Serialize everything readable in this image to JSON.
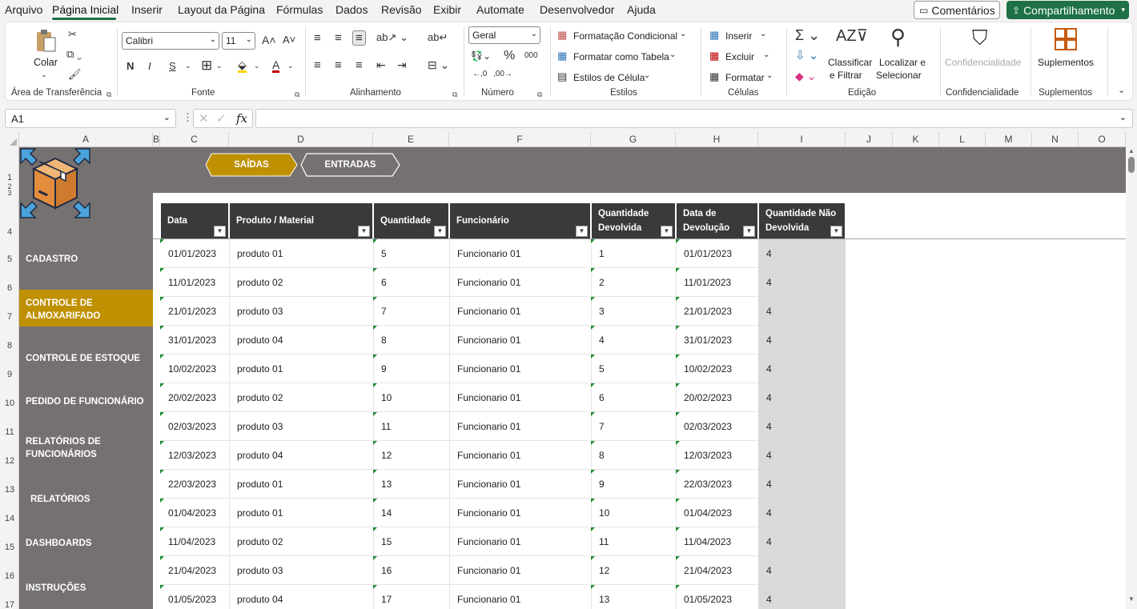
{
  "menu": {
    "items": [
      "Arquivo",
      "Página Inicial",
      "Inserir",
      "Layout da Página",
      "Fórmulas",
      "Dados",
      "Revisão",
      "Exibir",
      "Automate",
      "Desenvolvedor",
      "Ajuda"
    ],
    "comments": "Comentários",
    "share": "Compartilhamento"
  },
  "ribbon": {
    "clipboard": {
      "paste": "Colar",
      "label": "Área de Transferência"
    },
    "font": {
      "name": "Calibri",
      "size": "11",
      "bold": "N",
      "italic": "I",
      "underline": "S",
      "label": "Fonte"
    },
    "alignment": {
      "label": "Alinhamento"
    },
    "number": {
      "format": "Geral",
      "label": "Número"
    },
    "styles": {
      "conditional": "Formatação Condicional",
      "table": "Formatar como Tabela",
      "cell": "Estilos de Célula",
      "label": "Estilos"
    },
    "cells": {
      "insert": "Inserir",
      "delete": "Excluir",
      "format": "Formatar",
      "label": "Células"
    },
    "editing": {
      "sort1": "Classificar",
      "sort2": "e Filtrar",
      "find1": "Localizar e",
      "find2": "Selecionar",
      "label": "Edição"
    },
    "sensitivity": {
      "btn": "Confidencialidade",
      "label": "Confidencialidade"
    },
    "addins": {
      "btn": "Suplementos",
      "label": "Suplementos"
    }
  },
  "formula_bar": {
    "namebox": "A1",
    "fx": "fx",
    "value": ""
  },
  "columns": [
    "A",
    "B",
    "C",
    "D",
    "E",
    "F",
    "G",
    "H",
    "I",
    "J",
    "K",
    "L",
    "M",
    "N",
    "O"
  ],
  "rows": [
    "1",
    "2",
    "3",
    "4",
    "5",
    "6",
    "7",
    "8",
    "9",
    "10",
    "11",
    "12",
    "13",
    "14",
    "15",
    "16",
    "17"
  ],
  "nav": {
    "saidas": "SAÍDAS",
    "entradas": "ENTRADAS"
  },
  "sidebar": {
    "items": [
      {
        "label": "CADASTRO"
      },
      {
        "label": "CONTROLE DE ALMOXARIFADO"
      },
      {
        "label": "CONTROLE DE ESTOQUE"
      },
      {
        "label": "PEDIDO DE FUNCIONÁRIO"
      },
      {
        "label": "RELATÓRIOS DE FUNCIONÁRIOS"
      },
      {
        "label": "RELATÓRIOS"
      },
      {
        "label": "DASHBOARDS"
      },
      {
        "label": "INSTRUÇÕES"
      }
    ]
  },
  "table": {
    "headers": [
      "Data",
      "Produto / Material",
      "Quantidade",
      "Funcionário",
      "Quantidade Devolvida",
      "Data de Devolução",
      "Quantidade Não Devolvida"
    ],
    "rows": [
      [
        "01/01/2023",
        "produto 01",
        "5",
        "Funcionario 01",
        "1",
        "01/01/2023",
        "4"
      ],
      [
        "11/01/2023",
        "produto 02",
        "6",
        "Funcionario 01",
        "2",
        "11/01/2023",
        "4"
      ],
      [
        "21/01/2023",
        "produto 03",
        "7",
        "Funcionario 01",
        "3",
        "21/01/2023",
        "4"
      ],
      [
        "31/01/2023",
        "produto 04",
        "8",
        "Funcionario 01",
        "4",
        "31/01/2023",
        "4"
      ],
      [
        "10/02/2023",
        "produto 01",
        "9",
        "Funcionario 01",
        "5",
        "10/02/2023",
        "4"
      ],
      [
        "20/02/2023",
        "produto 02",
        "10",
        "Funcionario 01",
        "6",
        "20/02/2023",
        "4"
      ],
      [
        "02/03/2023",
        "produto 03",
        "11",
        "Funcionario 01",
        "7",
        "02/03/2023",
        "4"
      ],
      [
        "12/03/2023",
        "produto 04",
        "12",
        "Funcionario 01",
        "8",
        "12/03/2023",
        "4"
      ],
      [
        "22/03/2023",
        "produto 01",
        "13",
        "Funcionario 01",
        "9",
        "22/03/2023",
        "4"
      ],
      [
        "01/04/2023",
        "produto 01",
        "14",
        "Funcionario 01",
        "10",
        "01/04/2023",
        "4"
      ],
      [
        "11/04/2023",
        "produto 02",
        "15",
        "Funcionario 01",
        "11",
        "11/04/2023",
        "4"
      ],
      [
        "21/04/2023",
        "produto 03",
        "16",
        "Funcionario 01",
        "12",
        "21/04/2023",
        "4"
      ],
      [
        "01/05/2023",
        "produto 04",
        "17",
        "Funcionario 01",
        "13",
        "01/05/2023",
        "4"
      ]
    ]
  },
  "colors": {
    "accent": "#bf9000",
    "panel": "#767171",
    "header": "#3a3a3a",
    "excel_green": "#1e7145"
  }
}
